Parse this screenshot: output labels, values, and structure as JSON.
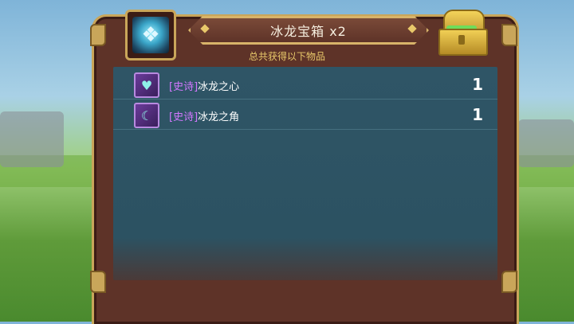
{
  "dialog": {
    "title": "冰龙宝箱 x2",
    "subtitle": "总共获得以下物品"
  },
  "items": [
    {
      "rarity": "[史诗]",
      "name": "冰龙之心",
      "count": "1",
      "icon": "ice-heart-icon"
    },
    {
      "rarity": "[史诗]",
      "name": "冰龙之角",
      "count": "1",
      "icon": "ice-horn-icon"
    }
  ],
  "colors": {
    "panel": "#5e3328",
    "gold_border": "#c9a65a",
    "list_bg": "#2f5566",
    "rarity_epic": "#d277ff",
    "subtitle": "#e8c86a"
  }
}
